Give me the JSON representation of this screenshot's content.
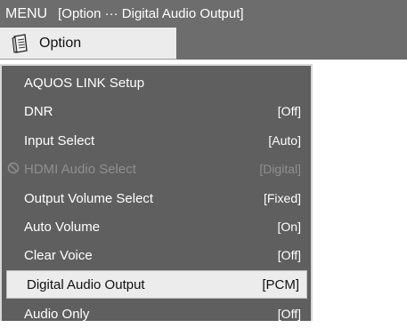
{
  "header": {
    "menu": "MENU",
    "breadcrumb": "[Option ··· Digital Audio Output]"
  },
  "tab": {
    "label": "Option",
    "icon": "option-page-icon"
  },
  "menu_items": [
    {
      "label": "AQUOS LINK Setup",
      "value": ""
    },
    {
      "label": "DNR",
      "value": "[Off]"
    },
    {
      "label": "Input Select",
      "value": "[Auto]"
    },
    {
      "label": "HDMI Audio Select",
      "value": "[Digital]",
      "disabled": true
    },
    {
      "label": "Output Volume Select",
      "value": "[Fixed]"
    },
    {
      "label": "Auto Volume",
      "value": "[On]"
    },
    {
      "label": "Clear Voice",
      "value": "[Off]"
    },
    {
      "label": "Digital Audio Output",
      "value": "[PCM]",
      "selected": true
    },
    {
      "label": "Audio Only",
      "value": "[Off]"
    }
  ],
  "colors": {
    "header_bg": "#6d6d6d",
    "panel_bg": "#5f5f5f",
    "selected_bg": "#ececec",
    "disabled_text": "#8f8f8f"
  }
}
